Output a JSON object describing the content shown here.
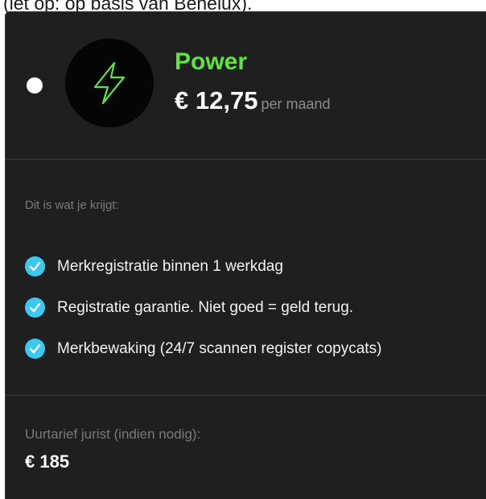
{
  "top_note": "(let op: op basis van Benelux).",
  "plan": {
    "name": "Power",
    "price": "€ 12,75",
    "period": "per maand",
    "icon": "lightning-bolt-icon",
    "accent_color": "#5ee63a"
  },
  "features": {
    "heading": "Dit is wat je krijgt:",
    "check_color": "#3cc8f0",
    "items": [
      {
        "label": "Merkregistratie binnen 1 werkdag"
      },
      {
        "label": "Registratie garantie. Niet goed = geld terug."
      },
      {
        "label": "Merkbewaking (24/7 scannen register copycats)"
      }
    ]
  },
  "rate": {
    "label": "Uurtarief jurist (indien nodig):",
    "value": "€ 185"
  }
}
